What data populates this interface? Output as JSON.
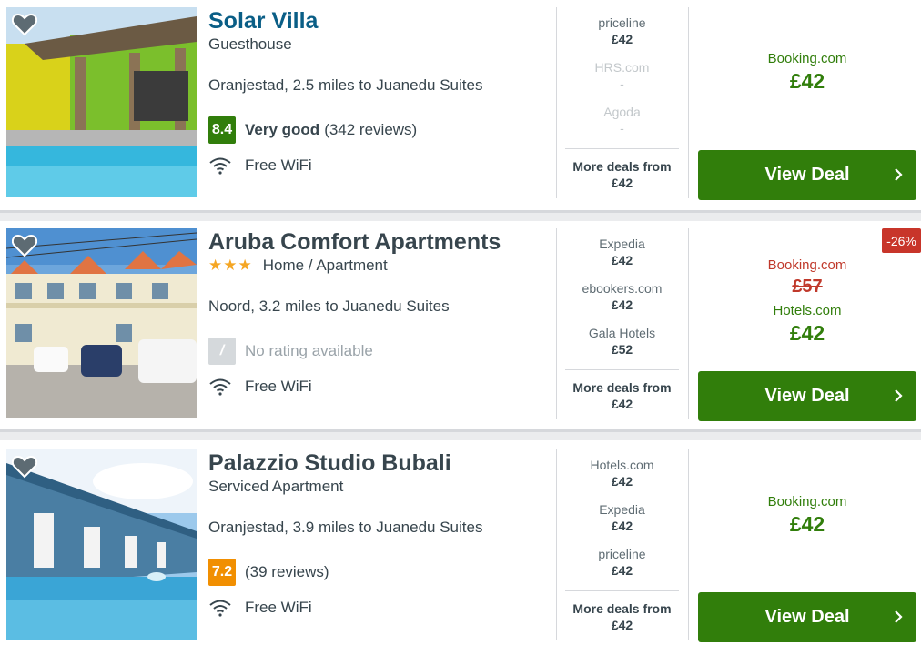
{
  "hotels": [
    {
      "name": "Solar Villa",
      "type": "Guesthouse",
      "stars": "",
      "location": "Oranjestad, 2.5 miles to Juanedu Suites",
      "score": "8.4",
      "score_color": "#317e0b",
      "rating_word": "Very good",
      "reviews": "(342 reviews)",
      "amenity": "Free WiFi",
      "deals": [
        {
          "provider": "priceline",
          "price": "£42"
        },
        {
          "provider": "HRS.com",
          "price": "-"
        },
        {
          "provider": "Agoda",
          "price": "-"
        }
      ],
      "more_label": "More deals from",
      "more_price": "£42",
      "best_provider": "Booking.com",
      "best_price": "£42",
      "button_label": "View Deal"
    },
    {
      "name": "Aruba Comfort Apartments",
      "stars": "★★★",
      "type": "Home / Apartment",
      "location": "Noord, 3.2 miles to Juanedu Suites",
      "score": "/",
      "rating_text": "No rating available",
      "amenity": "Free WiFi",
      "deals": [
        {
          "provider": "Expedia",
          "price": "£42"
        },
        {
          "provider": "ebookers.com",
          "price": "£42"
        },
        {
          "provider": "Gala Hotels",
          "price": "£52"
        }
      ],
      "more_label": "More deals from",
      "more_price": "£42",
      "discount": "-26%",
      "old_provider": "Booking.com",
      "old_price": "£57",
      "best_provider": "Hotels.com",
      "best_price": "£42",
      "button_label": "View Deal"
    },
    {
      "name": "Palazzio Studio Bubali",
      "type": "Serviced Apartment",
      "location": "Oranjestad, 3.9 miles to Juanedu Suites",
      "score": "7.2",
      "score_color": "#f18f01",
      "reviews": "(39 reviews)",
      "amenity": "Free WiFi",
      "deals": [
        {
          "provider": "Hotels.com",
          "price": "£42"
        },
        {
          "provider": "Expedia",
          "price": "£42"
        },
        {
          "provider": "priceline",
          "price": "£42"
        }
      ],
      "more_label": "More deals from",
      "more_price": "£42",
      "best_provider": "Booking.com",
      "best_price": "£42",
      "button_label": "View Deal"
    }
  ],
  "colors": {
    "deal_green": "#317e0b",
    "title_blue": "#0a5e86",
    "discount_red": "#c8352a"
  }
}
